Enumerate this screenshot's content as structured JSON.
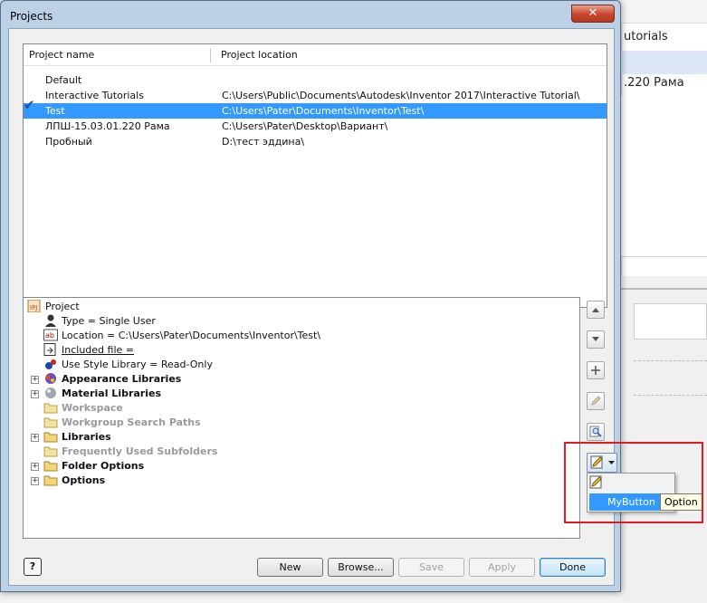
{
  "window": {
    "title": "Projects",
    "close_glyph": "✕"
  },
  "background": {
    "rows": [
      "utorials",
      "",
      ".220 Рама"
    ]
  },
  "project_list": {
    "columns": [
      "Project name",
      "Project location"
    ],
    "rows": [
      {
        "name": "Default",
        "location": "",
        "active": false,
        "selected": false
      },
      {
        "name": "Interactive Tutorials",
        "location": "C:\\Users\\Public\\Documents\\Autodesk\\Inventor 2017\\Interactive Tutorial\\",
        "active": false,
        "selected": false
      },
      {
        "name": "Test",
        "location": "C:\\Users\\Pater\\Documents\\Inventor\\Test\\",
        "active": true,
        "selected": true
      },
      {
        "name": "ЛПШ-15.03.01.220 Рама",
        "location": "C:\\Users\\Pater\\Desktop\\Вариант\\",
        "active": false,
        "selected": false
      },
      {
        "name": "Пробный",
        "location": "D:\\тест эддина\\",
        "active": false,
        "selected": false
      }
    ]
  },
  "tree": {
    "project": "Project",
    "type": "Type = Single User",
    "location": "Location = C:\\Users\\Pater\\Documents\\Inventor\\Test\\",
    "included_file": "Included file = ",
    "style_library": "Use Style Library = Read-Only",
    "appearance_libraries": "Appearance Libraries",
    "material_libraries": "Material Libraries",
    "workspace": "Workspace",
    "workgroup_search_paths": "Workgroup Search Paths",
    "libraries": "Libraries",
    "frequently_used_subfolders": "Frequently Used Subfolders",
    "folder_options": "Folder Options",
    "options": "Options"
  },
  "popup": {
    "item": "MyButton",
    "tooltip": "Option"
  },
  "buttons": {
    "help": "?",
    "new": "New",
    "browse": "Browse...",
    "save": "Save",
    "apply": "Apply",
    "done": "Done"
  },
  "icons": {
    "active_check": "checkmark-icon",
    "move_up": "arrow-up-icon",
    "move_down": "arrow-down-icon",
    "add": "plus-icon",
    "edit": "pencil-icon",
    "find": "magnifier-icon",
    "custom": "custom-command-icon"
  }
}
